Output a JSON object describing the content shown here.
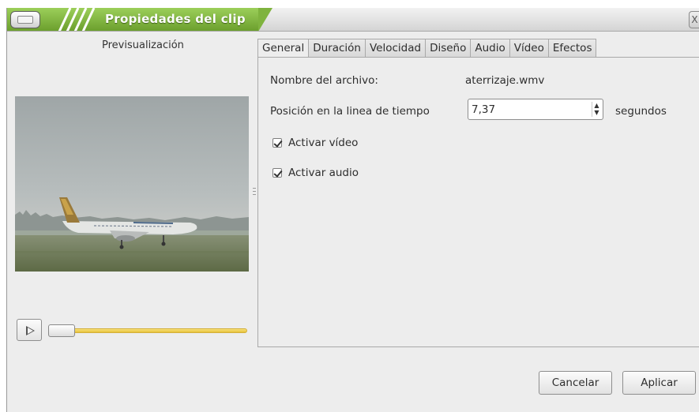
{
  "window": {
    "title": "Propiedades del clip",
    "close_glyph": "X"
  },
  "preview": {
    "label": "Previsualización",
    "slider_position": 0.0,
    "play_icon": "play-icon"
  },
  "tabs": [
    {
      "label": "General",
      "active": true
    },
    {
      "label": "Duración",
      "active": false
    },
    {
      "label": "Velocidad",
      "active": false
    },
    {
      "label": "Diseño",
      "active": false
    },
    {
      "label": "Audio",
      "active": false
    },
    {
      "label": "Vídeo",
      "active": false
    },
    {
      "label": "Efectos",
      "active": false
    }
  ],
  "general": {
    "filename_label": "Nombre del archivo:",
    "filename_value": "aterrizaje.wmv",
    "position_label": "Posición en la linea de tiempo",
    "position_value": "7,37",
    "position_units": "segundos",
    "enable_video_label": "Activar vídeo",
    "enable_video_checked": true,
    "enable_audio_label": "Activar audio",
    "enable_audio_checked": true
  },
  "buttons": {
    "cancel": "Cancelar",
    "apply": "Aplicar"
  },
  "colors": {
    "titlebar_green": "#7fb33e",
    "slider_yellow": "#e7c23a"
  }
}
